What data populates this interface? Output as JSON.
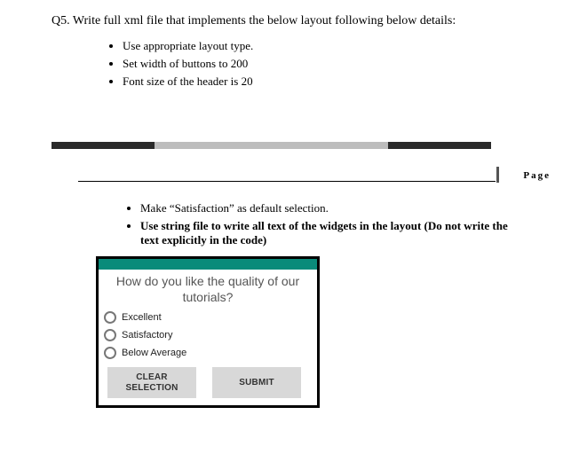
{
  "question_title": "Q5. Write full xml file that implements the below layout following below details:",
  "requirements_top": {
    "item0": "Use appropriate layout type.",
    "item1": "Set width of buttons to 200",
    "item2": "Font size of the header is 20"
  },
  "page_label": "Page",
  "requirements_bottom": {
    "item0": "Make “Satisfaction” as default selection.",
    "item1": "Use string file to write all text of the widgets in the layout (Do not write the text explicitly in the code)"
  },
  "mockup": {
    "header": "How do you like the quality of our tutorials?",
    "options": {
      "opt0": "Excellent",
      "opt1": "Satisfactory",
      "opt2": "Below Average"
    },
    "buttons": {
      "clear": "CLEAR SELECTION",
      "submit": "SUBMIT"
    }
  }
}
